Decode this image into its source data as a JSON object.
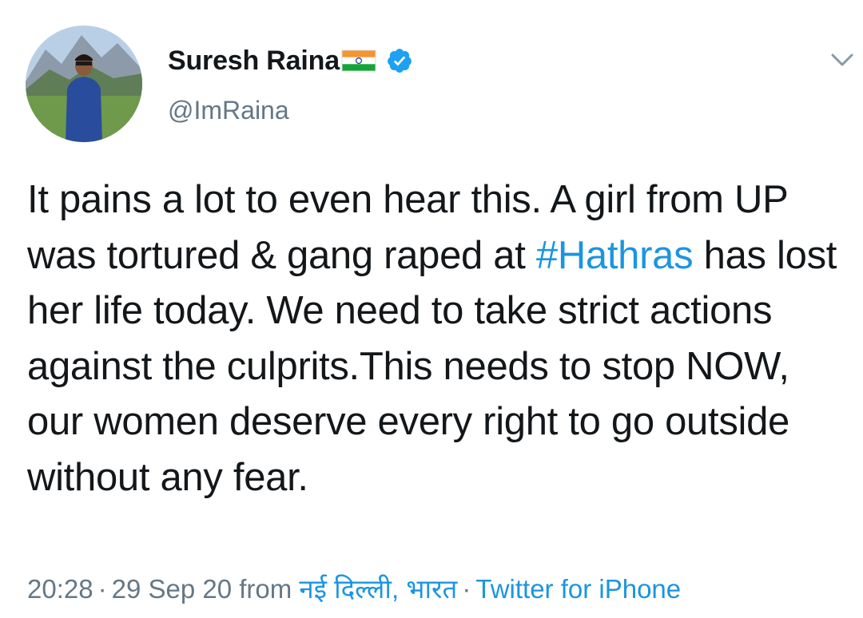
{
  "author": {
    "display_name": "Suresh Raina",
    "handle": "@ImRaina",
    "flag_emoji": "indian-flag",
    "verified_badge": "verified-check-icon"
  },
  "tweet": {
    "text_before_hashtag": "It pains a lot to even hear this. A girl from UP was tortured & gang raped at ",
    "hashtag": "#Hathras",
    "text_after_hashtag": " has lost her life today. We need to take strict actions against the culprits.This needs to stop NOW, our women deserve every right to go outside without any fear."
  },
  "meta": {
    "time": "20:28",
    "separator": "·",
    "date": "29 Sep 20",
    "from_label": "from",
    "location": "नई दिल्ली, भारत",
    "client": "Twitter for iPhone"
  },
  "icons": {
    "menu": "chevron-down-icon"
  },
  "colors": {
    "text": "#14171a",
    "secondary": "#657786",
    "link": "#1b95e0",
    "verified": "#1da1f2"
  }
}
